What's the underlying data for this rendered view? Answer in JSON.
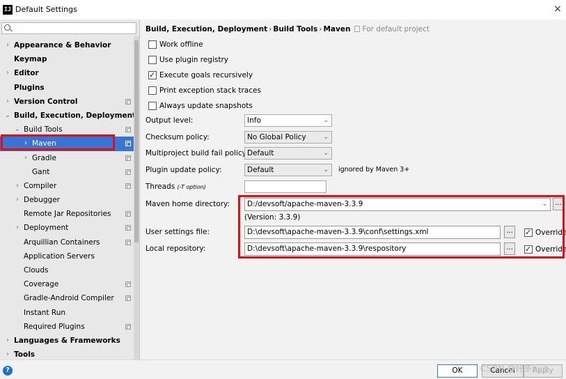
{
  "window": {
    "title": "Default Settings",
    "icon_text": "IJ"
  },
  "sidebar": {
    "items": [
      {
        "label": "Appearance & Behavior",
        "arrow": "›",
        "bold": true,
        "level": 0,
        "copy": false
      },
      {
        "label": "Keymap",
        "arrow": "",
        "bold": true,
        "level": 0,
        "copy": false
      },
      {
        "label": "Editor",
        "arrow": "›",
        "bold": true,
        "level": 0,
        "copy": false
      },
      {
        "label": "Plugins",
        "arrow": "",
        "bold": true,
        "level": 0,
        "copy": false
      },
      {
        "label": "Version Control",
        "arrow": "›",
        "bold": true,
        "level": 0,
        "copy": true
      },
      {
        "label": "Build, Execution, Deployment",
        "arrow": "⌄",
        "bold": true,
        "level": 0,
        "copy": false
      },
      {
        "label": "Build Tools",
        "arrow": "⌄",
        "bold": false,
        "level": 1,
        "copy": true
      },
      {
        "label": "Maven",
        "arrow": "›",
        "bold": false,
        "level": 2,
        "copy": true,
        "selected": true
      },
      {
        "label": "Gradle",
        "arrow": "›",
        "bold": false,
        "level": 2,
        "copy": true
      },
      {
        "label": "Gant",
        "arrow": "",
        "bold": false,
        "level": 2,
        "copy": true
      },
      {
        "label": "Compiler",
        "arrow": "›",
        "bold": false,
        "level": 1,
        "copy": true
      },
      {
        "label": "Debugger",
        "arrow": "›",
        "bold": false,
        "level": 1,
        "copy": false
      },
      {
        "label": "Remote Jar Repositories",
        "arrow": "",
        "bold": false,
        "level": 1,
        "copy": true
      },
      {
        "label": "Deployment",
        "arrow": "›",
        "bold": false,
        "level": 1,
        "copy": true
      },
      {
        "label": "Arquillian Containers",
        "arrow": "",
        "bold": false,
        "level": 1,
        "copy": true
      },
      {
        "label": "Application Servers",
        "arrow": "",
        "bold": false,
        "level": 1,
        "copy": false
      },
      {
        "label": "Clouds",
        "arrow": "",
        "bold": false,
        "level": 1,
        "copy": false
      },
      {
        "label": "Coverage",
        "arrow": "",
        "bold": false,
        "level": 1,
        "copy": true
      },
      {
        "label": "Gradle-Android Compiler",
        "arrow": "",
        "bold": false,
        "level": 1,
        "copy": true
      },
      {
        "label": "Instant Run",
        "arrow": "",
        "bold": false,
        "level": 1,
        "copy": false
      },
      {
        "label": "Required Plugins",
        "arrow": "",
        "bold": false,
        "level": 1,
        "copy": true
      },
      {
        "label": "Languages & Frameworks",
        "arrow": "›",
        "bold": true,
        "level": 0,
        "copy": false
      },
      {
        "label": "Tools",
        "arrow": "›",
        "bold": true,
        "level": 0,
        "copy": false
      }
    ]
  },
  "breadcrumb": {
    "part1": "Build, Execution, Deployment",
    "part2": "Build Tools",
    "part3": "Maven",
    "separator": "›",
    "for_default": "For default project"
  },
  "checkboxes": {
    "work_offline": {
      "label": "Work offline",
      "checked": false
    },
    "use_plugin_registry": {
      "label": "Use plugin registry",
      "checked": false
    },
    "execute_goals_recursively": {
      "label": "Execute goals recursively",
      "checked": true
    },
    "print_exception_stack_traces": {
      "label": "Print exception stack traces",
      "checked": false
    },
    "always_update_snapshots": {
      "label": "Always update snapshots",
      "checked": false
    }
  },
  "fields": {
    "output_level": {
      "label": "Output level:",
      "value": "Info"
    },
    "checksum_policy": {
      "label": "Checksum policy:",
      "value": "No Global Policy"
    },
    "multiproject_fail_policy": {
      "label": "Multiproject build fail policy:",
      "value": "Default"
    },
    "plugin_update_policy": {
      "label": "Plugin update policy:",
      "value": "Default",
      "note": "ignored by Maven 3+"
    },
    "threads": {
      "label": "Threads",
      "hint": "(-T option)",
      "value": ""
    },
    "maven_home": {
      "label": "Maven home directory:",
      "value": "D:/devsoft/apache-maven-3.3.9",
      "version": "(Version: 3.3.9)"
    },
    "user_settings": {
      "label": "User settings file:",
      "value": "D:\\devsoft\\apache-maven-3.3.9\\conf\\settings.xml",
      "override": "Override"
    },
    "local_repository": {
      "label": "Local repository:",
      "value": "D:\\devsoft\\apache-maven-3.3.9\\respository",
      "override": "Override"
    }
  },
  "dots": "...",
  "caret": "⌄",
  "buttons": {
    "ok": "OK",
    "cancel": "Cancel",
    "apply": "Apply"
  },
  "help": "?",
  "close": "×",
  "watermark": "CSDN @好多bug"
}
